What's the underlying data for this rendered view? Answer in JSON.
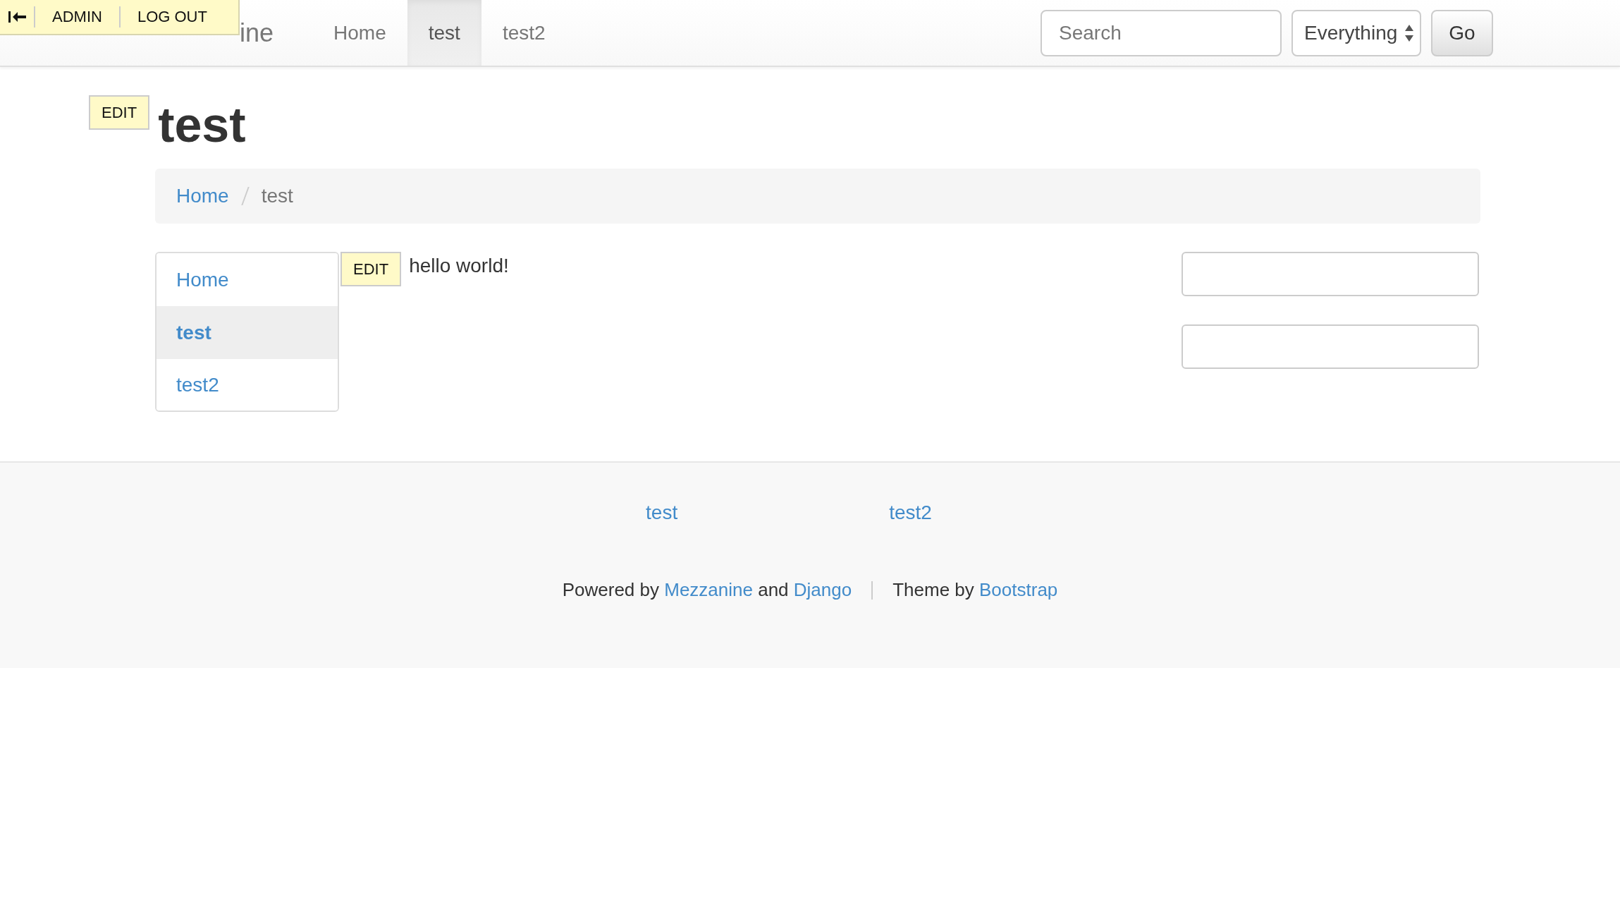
{
  "admin_toolbar": {
    "items": [
      {
        "kind": "collapse"
      },
      {
        "kind": "link",
        "label": "ADMIN"
      },
      {
        "kind": "link",
        "label": "LOG OUT"
      }
    ]
  },
  "navbar": {
    "brand": "ine",
    "items": [
      {
        "label": "Home",
        "selected": false
      },
      {
        "label": "test",
        "selected": true
      },
      {
        "label": "test2",
        "selected": false
      }
    ],
    "search": {
      "placeholder": "Search"
    },
    "scope": {
      "value": "Everything"
    },
    "button": "Go"
  },
  "page": {
    "edit_label": "EDIT",
    "title": "test"
  },
  "breadcrumb": [
    {
      "label": "Home",
      "kind": "link"
    },
    {
      "label": "test",
      "kind": "current"
    }
  ],
  "sidebar": {
    "items": [
      {
        "label": "Home",
        "selected": false
      },
      {
        "label": "test",
        "selected": true
      },
      {
        "label": "test2",
        "selected": false
      }
    ]
  },
  "content": {
    "edit_label": "EDIT",
    "text": "hello world!"
  },
  "right_fields": [
    {
      "kind": "input"
    },
    {
      "kind": "input"
    }
  ],
  "footer": {
    "links": [
      "test",
      "test2"
    ],
    "credits": [
      [
        {
          "text": "Powered by ",
          "kind": "text"
        },
        {
          "text": "Mezzanine",
          "kind": "link"
        },
        {
          "text": " and ",
          "kind": "text"
        },
        {
          "text": "Django",
          "kind": "link"
        }
      ],
      [
        {
          "text": "Theme by ",
          "kind": "text"
        },
        {
          "text": "Bootstrap",
          "kind": "link"
        }
      ]
    ]
  }
}
